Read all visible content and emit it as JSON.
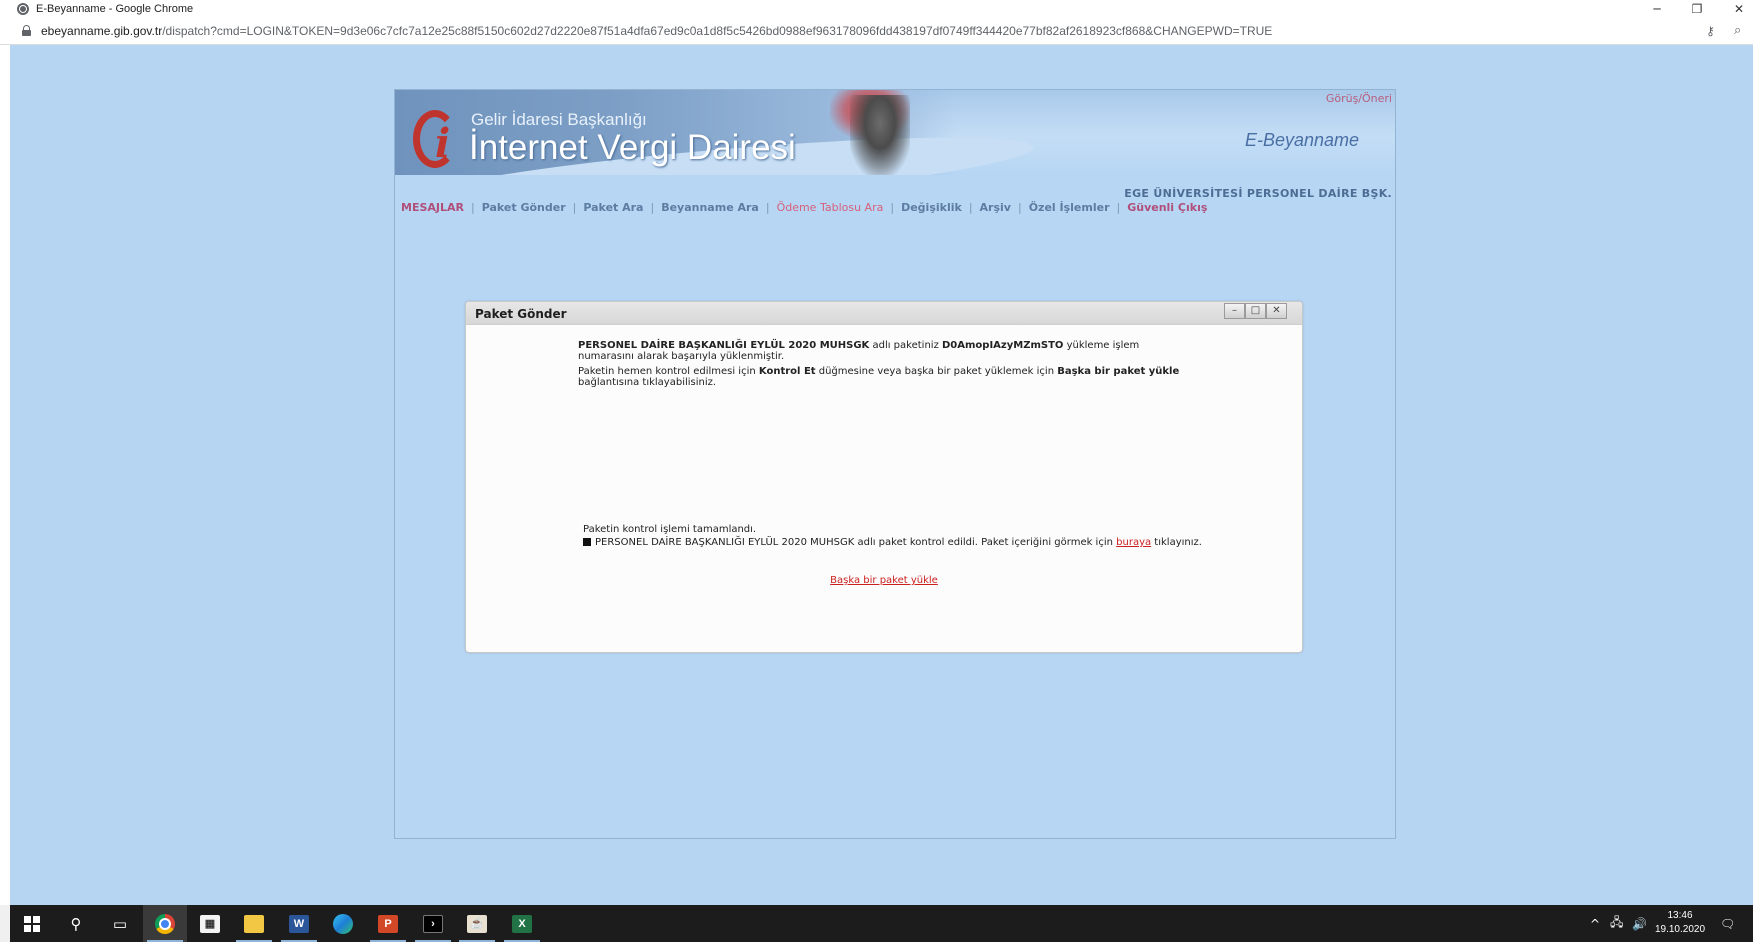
{
  "window": {
    "title": "E-Beyanname - Google Chrome",
    "minimize_glyph": "─",
    "restore_glyph": "❐",
    "close_glyph": "✕"
  },
  "address_bar": {
    "host": "ebeyanname.gib.gov.tr",
    "path": "/dispatch?cmd=LOGIN&TOKEN=9d3e06c7cfc7a12e25c88f5150c602d27d2220e87f51a4dfa67ed9c0a1d8f5c5426bd0988ef963178096fdd438197df0749ff344420e77bf82af2618923cf868&CHANGEPWD=TRUE",
    "key_icon": "key-icon",
    "zoom_icon": "zoom-icon"
  },
  "site": {
    "org_name": "Gelir İdaresi Başkanlığı",
    "site_name": "İnternet Vergi Dairesi",
    "product": "E-Beyanname",
    "feedback_link": "Görüş/Öneri",
    "user_org": "EGE ÜNİVERSİTESİ PERSONEL DAİRE BŞK."
  },
  "menu": {
    "items": [
      "MESAJLAR",
      "Paket Gönder",
      "Paket Ara",
      "Beyanname Ara",
      "Ödeme Tablosu Ara",
      "Değişiklik",
      "Arşiv",
      "Özel İşlemler",
      "Güvenli Çıkış"
    ],
    "separator": "|"
  },
  "dialog": {
    "title": "Paket Gönder",
    "buttons": {
      "minimize": "–",
      "maximize": "□",
      "close": "✕"
    },
    "upload": {
      "package_name": "PERSONEL DAİRE BAŞKANLIĞI EYLÜL 2020 MUHSGK",
      "text_a": " adlı paketiniz ",
      "upload_id": "D0AmopIAzyMZmSTO",
      "text_b": " yükleme işlem numarasını alarak başarıyla yüklenmiştir."
    },
    "hint": {
      "text_a": "Paketin hemen kontrol edilmesi için ",
      "control_button": "Kontrol Et",
      "text_b": " düğmesine veya başka bir paket yüklemek için ",
      "other_link": "Başka bir paket yükle",
      "text_c": " bağlantısına tıklayabilisiniz."
    },
    "control_done": "Paketin kontrol işlemi tamamlandı.",
    "result": {
      "text_a": "PERSONEL DAİRE BAŞKANLIĞI EYLÜL 2020 MUHSGK adlı paket kontrol edildi. Paket içeriğini görmek için ",
      "link": "buraya",
      "text_b": " tıklayınız."
    },
    "another_package_link": "Başka bir paket yükle"
  },
  "taskbar": {
    "icons": [
      "start-icon",
      "search-icon",
      "task-view-icon",
      "chrome-icon",
      "store-icon",
      "file-explorer-icon",
      "word-icon",
      "edge-icon",
      "powerpoint-icon",
      "terminal-icon",
      "java-icon",
      "excel-icon"
    ],
    "tray_chevron": "^",
    "clock_time": "13:46",
    "clock_date": "19.10.2020"
  },
  "colors": {
    "page_background": "#b5d5f3",
    "menu_link": "#5d7ca2",
    "menu_highlight": "#b0507a",
    "link_red": "#cc1f1f"
  }
}
